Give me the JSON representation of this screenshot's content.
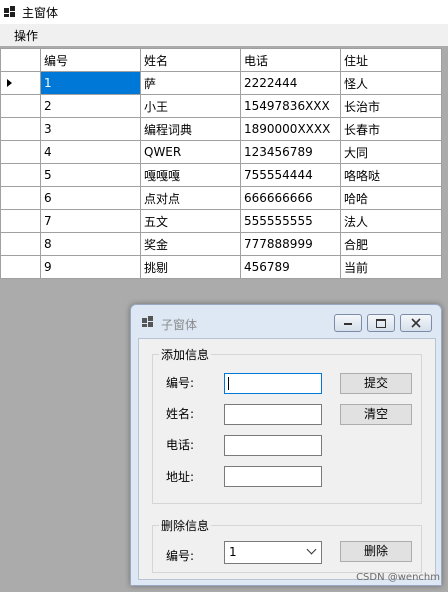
{
  "main_window": {
    "title": "主窗体",
    "menu": {
      "operate": "操作"
    }
  },
  "grid": {
    "columns": [
      "编号",
      "姓名",
      "电话",
      "住址"
    ],
    "selected_row": 0,
    "rows": [
      [
        "1",
        "萨",
        "2222444",
        "怪人"
      ],
      [
        "2",
        "小王",
        "15497836XXX",
        "长治市"
      ],
      [
        "3",
        "编程词典",
        "1890000XXXX",
        "长春市"
      ],
      [
        "4",
        "QWER",
        "123456789",
        "大同"
      ],
      [
        "5",
        "嘎嘎嘎",
        "755554444",
        "咯咯哒"
      ],
      [
        "6",
        "点对点",
        "666666666",
        "哈哈"
      ],
      [
        "7",
        "五文",
        "555555555",
        "法人"
      ],
      [
        "8",
        "奖金",
        "777888999",
        "合肥"
      ],
      [
        "9",
        "挑剔",
        "456789",
        "当前"
      ]
    ]
  },
  "child_window": {
    "title": "子窗体",
    "add_group": {
      "title": "添加信息",
      "id_label": "编号:",
      "name_label": "姓名:",
      "phone_label": "电话:",
      "address_label": "地址:",
      "id_value": "",
      "name_value": "",
      "phone_value": "",
      "address_value": "",
      "submit_label": "提交",
      "clear_label": "清空"
    },
    "delete_group": {
      "title": "删除信息",
      "id_label": "编号:",
      "selected_id": "1",
      "delete_label": "删除"
    }
  },
  "watermark": "CSDN @wenchm"
}
